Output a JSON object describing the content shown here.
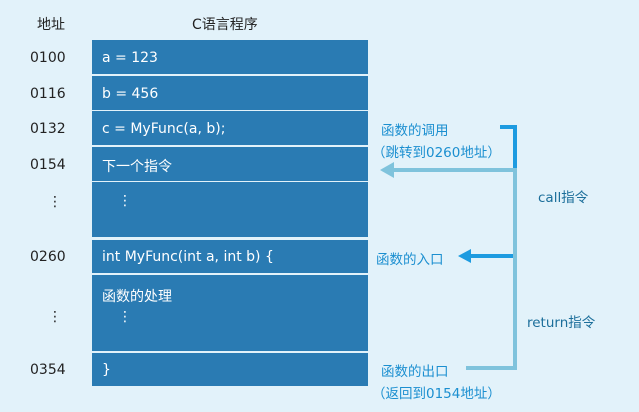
{
  "headers": {
    "address": "地址",
    "program": "C语言程序"
  },
  "rows": [
    {
      "addr": "0100",
      "code": "a = 123"
    },
    {
      "addr": "0116",
      "code": "b = 456"
    },
    {
      "addr": "0132",
      "code": "c = MyFunc(a, b);"
    },
    {
      "addr": "0154",
      "code": "下一个指令"
    },
    {
      "addr": "⋮",
      "code": "⋮"
    },
    {
      "addr": "0260",
      "code": "int MyFunc(int a, int b) {"
    },
    {
      "addr": "⋮",
      "code": "函数的处理"
    },
    {
      "addr": "0354",
      "code": "}"
    }
  ],
  "annotations": {
    "call_from": "函数的调用",
    "call_from_sub": "（跳转到0260地址）",
    "call_label": "call指令",
    "entry": "函数的入口",
    "return_label": "return指令",
    "exit": "函数的出口",
    "exit_sub": "（返回到0154地址）"
  },
  "colors": {
    "background": "#e2f2fa",
    "block": "#2a7bb3",
    "arrow_call": "#1d9be0",
    "arrow_return": "#7fc3dc"
  }
}
